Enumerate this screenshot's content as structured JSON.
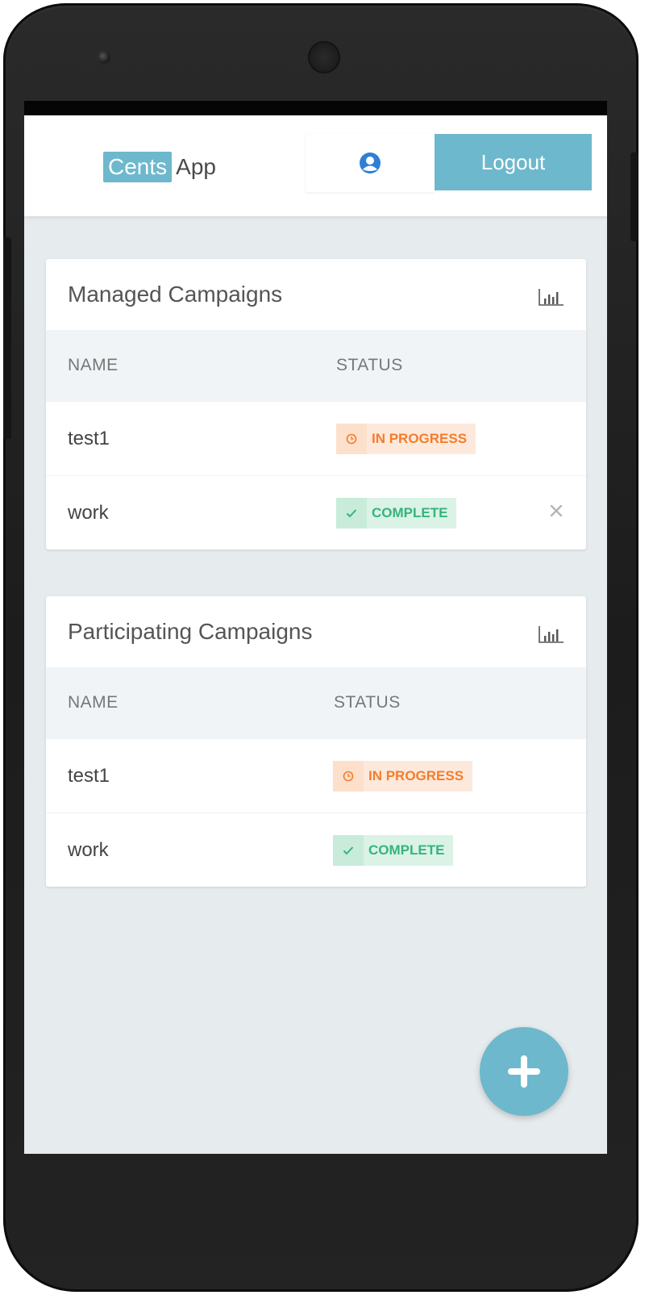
{
  "navbar": {
    "brand_highlight": "Cents",
    "brand_rest": "App",
    "profile_icon": "user-circle-icon",
    "logout_label": "Logout"
  },
  "managed": {
    "title": "Managed Campaigns",
    "col_name": "NAME",
    "col_status": "STATUS",
    "rows": [
      {
        "name": "test1",
        "status": "IN PROGRESS"
      },
      {
        "name": "work",
        "status": "COMPLETE"
      }
    ]
  },
  "participating": {
    "title": "Participating Campaigns",
    "col_name": "NAME",
    "col_status": "STATUS",
    "rows": [
      {
        "name": "test1",
        "status": "IN PROGRESS"
      },
      {
        "name": "work",
        "status": "COMPLETE"
      }
    ]
  },
  "colors": {
    "accent": "#6db8cc",
    "in_progress": "#f57c2b",
    "complete": "#35b37e",
    "background": "#e6ebee"
  }
}
